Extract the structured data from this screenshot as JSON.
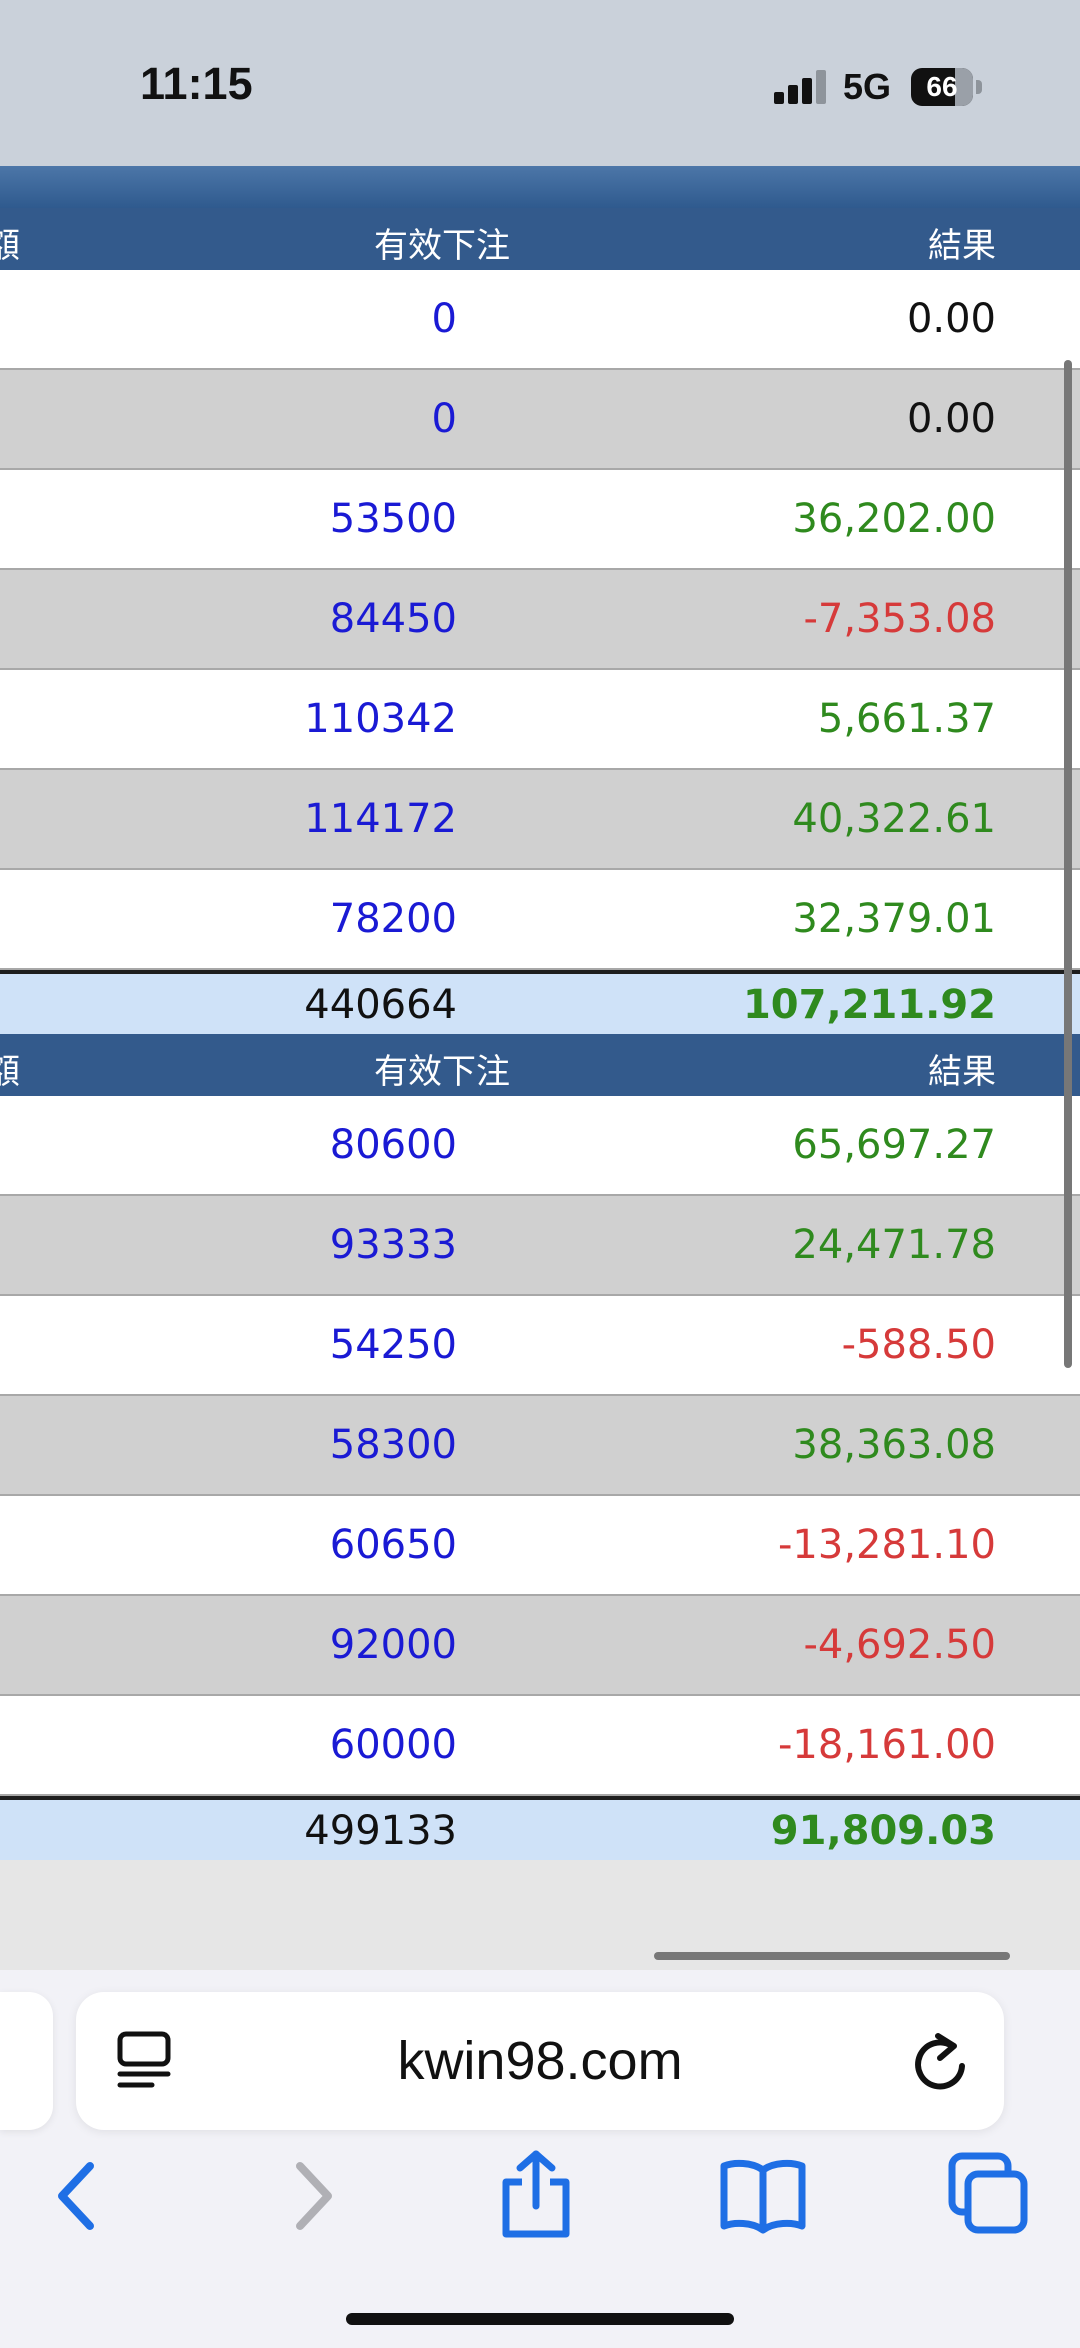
{
  "status_bar": {
    "time": "11:15",
    "network": "5G",
    "battery": "66"
  },
  "table_top": {
    "col_first_partial": "額",
    "col_bet": "有效下注",
    "col_result": "結果"
  },
  "section1": {
    "header": {
      "col_first_partial": "額",
      "col_bet": "有效下注",
      "col_result": "結果"
    },
    "rows": [
      {
        "bet": "0",
        "result": "0.00",
        "sign": "zero"
      },
      {
        "bet": "0",
        "result": "0.00",
        "sign": "zero"
      },
      {
        "bet": "53500",
        "result": "36,202.00",
        "sign": "pos"
      },
      {
        "bet": "84450",
        "result": "-7,353.08",
        "sign": "neg"
      },
      {
        "bet": "110342",
        "result": "5,661.37",
        "sign": "pos"
      },
      {
        "bet": "114172",
        "result": "40,322.61",
        "sign": "pos"
      },
      {
        "bet": "78200",
        "result": "32,379.01",
        "sign": "pos"
      }
    ],
    "total": {
      "bet": "440664",
      "result": "107,211.92"
    }
  },
  "section2": {
    "header": {
      "col_first_partial": "額",
      "col_bet": "有效下注",
      "col_result": "結果"
    },
    "rows": [
      {
        "bet": "80600",
        "result": "65,697.27",
        "sign": "pos"
      },
      {
        "bet": "93333",
        "result": "24,471.78",
        "sign": "pos"
      },
      {
        "bet": "54250",
        "result": "-588.50",
        "sign": "neg"
      },
      {
        "bet": "58300",
        "result": "38,363.08",
        "sign": "pos"
      },
      {
        "bet": "60650",
        "result": "-13,281.10",
        "sign": "neg"
      },
      {
        "bet": "92000",
        "result": "-4,692.50",
        "sign": "neg"
      },
      {
        "bet": "60000",
        "result": "-18,161.00",
        "sign": "neg"
      }
    ],
    "total": {
      "bet": "499133",
      "result": "91,809.03"
    }
  },
  "browser": {
    "url": "kwin98.com"
  },
  "icons": {
    "reader": "reader-mode-icon",
    "reload": "reload-icon",
    "back": "chevron-left-icon",
    "forward": "chevron-right-icon",
    "share": "share-icon",
    "bookmarks": "book-icon",
    "tabs": "tabs-icon"
  },
  "colors": {
    "positive": "#2f8a1e",
    "negative": "#d63a3a",
    "bet": "#1a1ad4",
    "header": "#335a8c",
    "total_bg": "#cfe2f8",
    "safari_blue": "#1f6fe5"
  }
}
